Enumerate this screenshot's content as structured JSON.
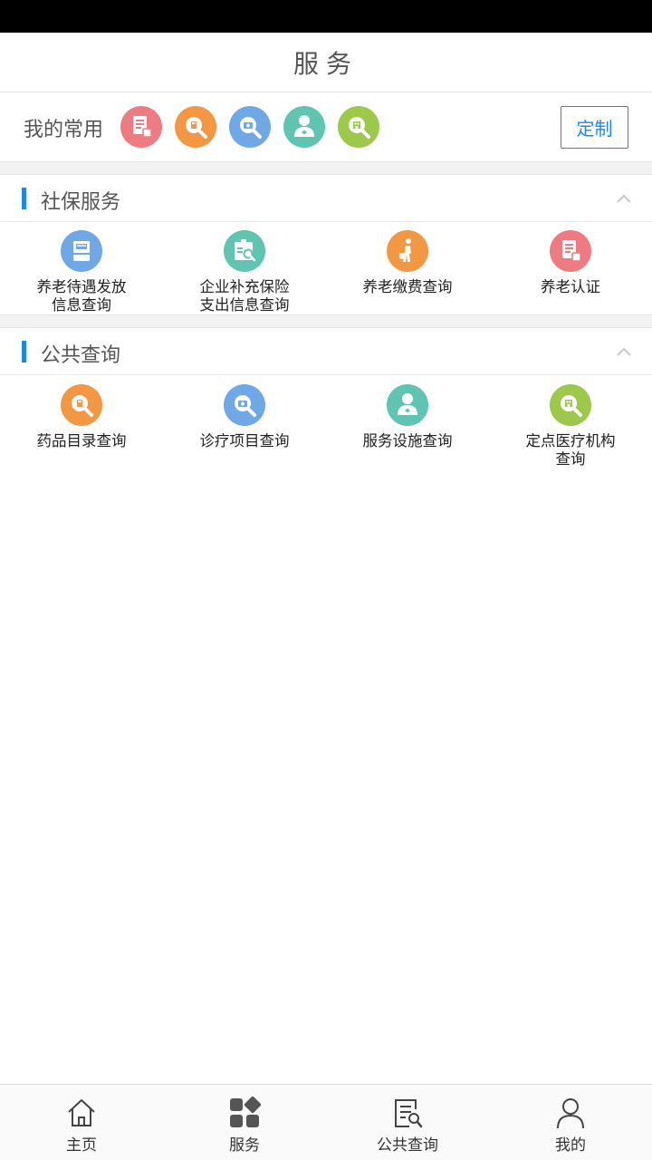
{
  "header": {
    "title": "服务"
  },
  "favorites": {
    "label": "我的常用",
    "custom_label": "定制",
    "icons": [
      {
        "name": "pension-certification-icon",
        "color": "#ee7b82"
      },
      {
        "name": "drug-search-icon",
        "color": "#f39743"
      },
      {
        "name": "treatment-search-icon",
        "color": "#6fa8e6"
      },
      {
        "name": "service-facility-icon",
        "color": "#5fc4b0"
      },
      {
        "name": "medical-institution-search-icon",
        "color": "#9dc94a"
      }
    ]
  },
  "sections": [
    {
      "title": "社保服务",
      "items": [
        {
          "label": "养老待遇发放\n信息查询",
          "icon": "pension-payout-icon",
          "color": "#6fa8e6"
        },
        {
          "label": "企业补充保险\n支出信息查询",
          "icon": "supplementary-insurance-icon",
          "color": "#5fc4b0"
        },
        {
          "label": "养老缴费查询",
          "icon": "pension-payment-icon",
          "color": "#f39743"
        },
        {
          "label": "养老认证",
          "icon": "pension-certification-icon",
          "color": "#ee7b82"
        }
      ]
    },
    {
      "title": "公共查询",
      "items": [
        {
          "label": "药品目录查询",
          "icon": "drug-search-icon",
          "color": "#f39743"
        },
        {
          "label": "诊疗项目查询",
          "icon": "treatment-search-icon",
          "color": "#6fa8e6"
        },
        {
          "label": "服务设施查询",
          "icon": "service-facility-icon",
          "color": "#5fc4b0"
        },
        {
          "label": "定点医疗机构\n查询",
          "icon": "medical-institution-search-icon",
          "color": "#9dc94a"
        }
      ]
    }
  ],
  "tabs": [
    {
      "label": "主页",
      "icon": "home-icon"
    },
    {
      "label": "服务",
      "icon": "services-grid-icon"
    },
    {
      "label": "公共查询",
      "icon": "public-query-icon"
    },
    {
      "label": "我的",
      "icon": "profile-icon"
    }
  ],
  "colors": {
    "accent": "#1e88e5",
    "background_gap": "#f2f2f2"
  }
}
